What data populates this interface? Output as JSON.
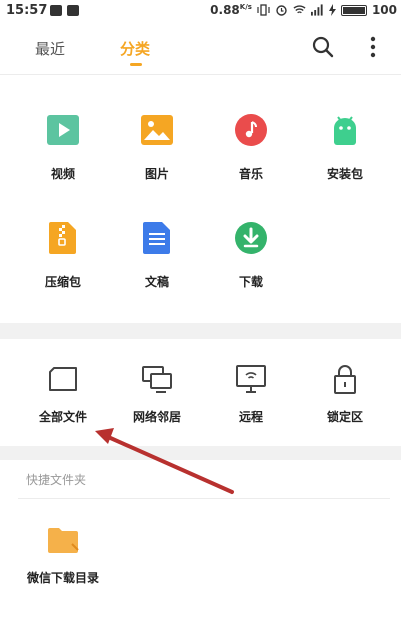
{
  "status_bar": {
    "time": "15:57",
    "speed": "0.88",
    "speed_unit": "K/s",
    "battery": "100"
  },
  "nav": {
    "tabs": [
      {
        "label": "最近",
        "active": false
      },
      {
        "label": "分类",
        "active": true
      }
    ],
    "accent_color": "#f5a623",
    "search_icon": "search-icon",
    "more_icon": "more-vertical-icon"
  },
  "categories": [
    {
      "label": "视频",
      "icon": "video-icon",
      "color": "#5cc4a0"
    },
    {
      "label": "图片",
      "icon": "image-icon",
      "color": "#f5a623"
    },
    {
      "label": "音乐",
      "icon": "music-icon",
      "color": "#ea4c4c"
    },
    {
      "label": "安装包",
      "icon": "android-icon",
      "color": "#3ecf8e"
    },
    {
      "label": "压缩包",
      "icon": "zip-icon",
      "color": "#f5a623"
    },
    {
      "label": "文稿",
      "icon": "document-icon",
      "color": "#3d7be9"
    },
    {
      "label": "下载",
      "icon": "download-icon",
      "color": "#34b36b"
    }
  ],
  "storage": [
    {
      "label": "全部文件",
      "icon": "sd-card-icon"
    },
    {
      "label": "网络邻居",
      "icon": "network-icon"
    },
    {
      "label": "远程",
      "icon": "remote-screen-icon"
    },
    {
      "label": "锁定区",
      "icon": "lock-icon"
    }
  ],
  "shortcuts": {
    "title": "快捷文件夹",
    "items": [
      {
        "label": "微信下载目录",
        "icon": "folder-icon",
        "color": "#f5b14a"
      }
    ]
  },
  "annotation": {
    "arrow_color": "#b8312f"
  }
}
